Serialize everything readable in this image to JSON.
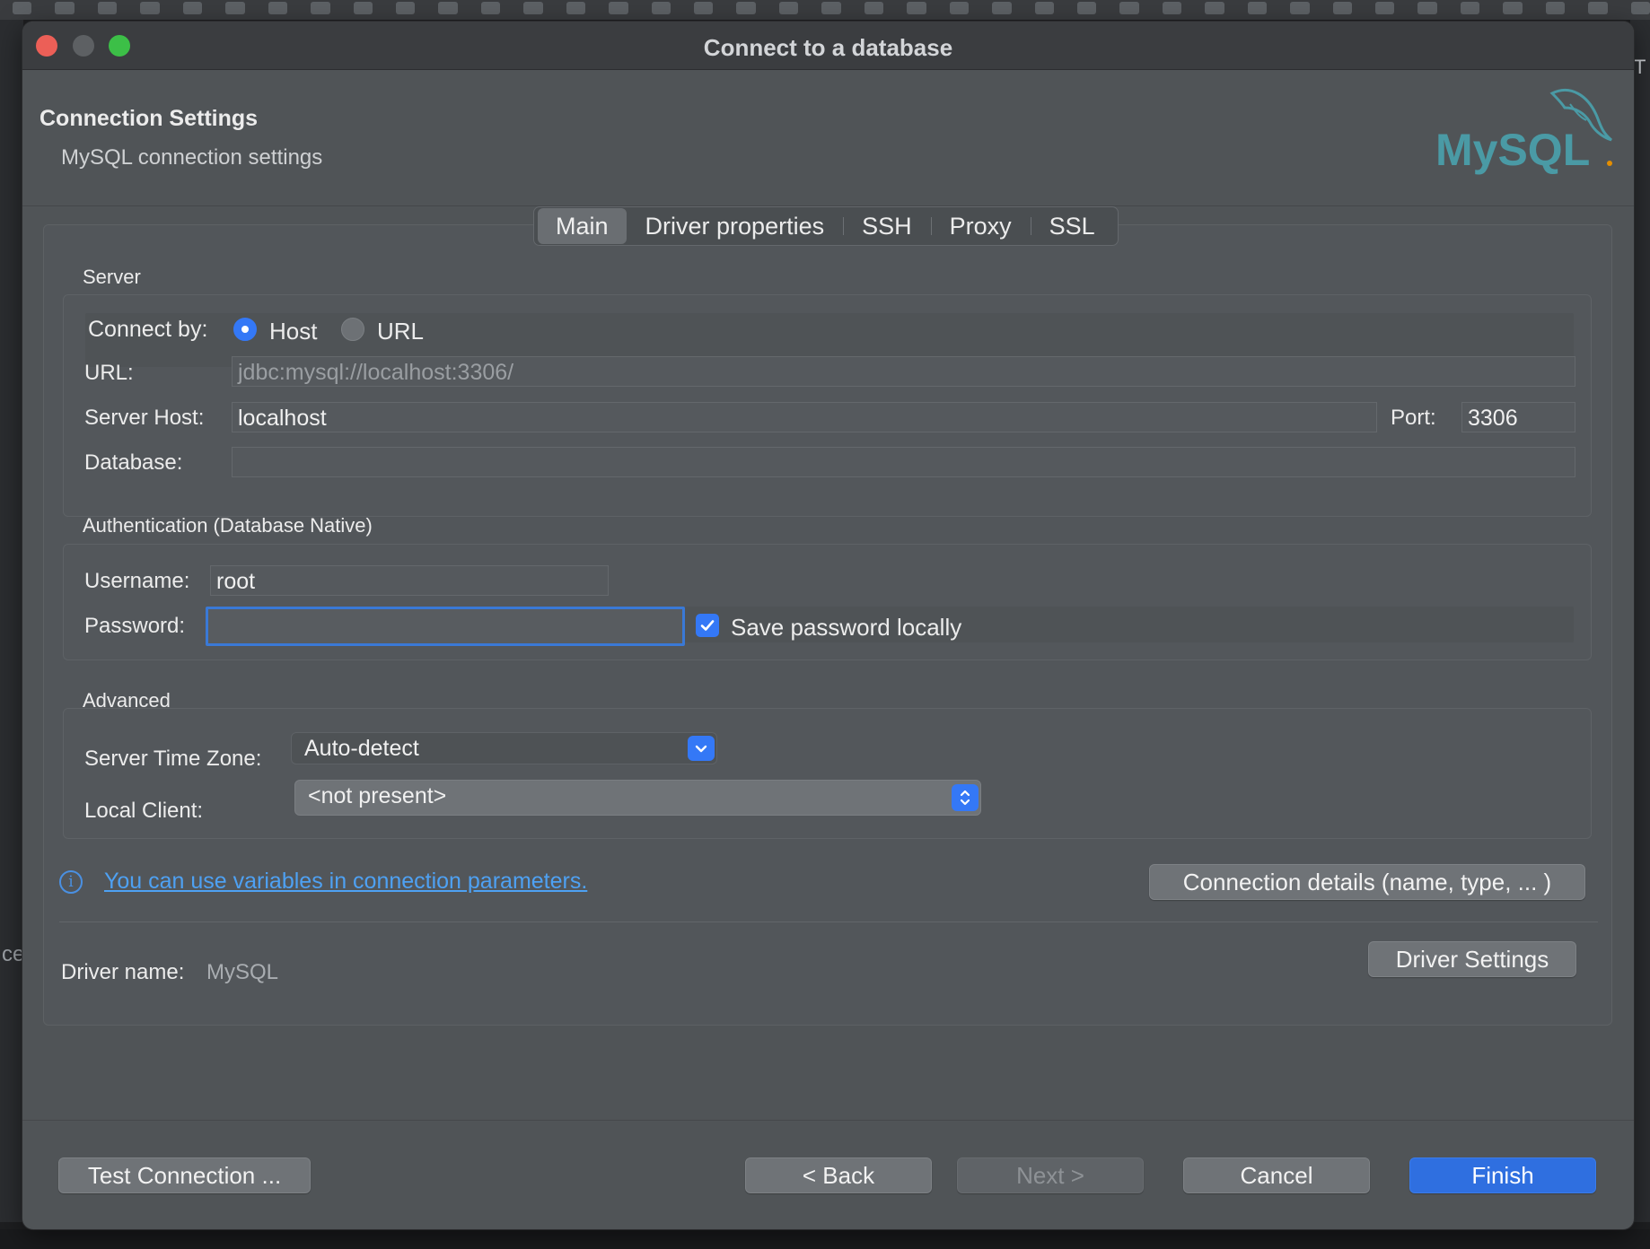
{
  "window": {
    "title": "Connect to a database"
  },
  "header": {
    "title": "Connection Settings",
    "subtitle": "MySQL connection settings",
    "logo_text": "MySQL"
  },
  "tabs": [
    {
      "label": "Main",
      "active": true
    },
    {
      "label": "Driver properties",
      "active": false
    },
    {
      "label": "SSH",
      "active": false
    },
    {
      "label": "Proxy",
      "active": false
    },
    {
      "label": "SSL",
      "active": false
    }
  ],
  "server": {
    "section_label": "Server",
    "connect_by_label": "Connect by:",
    "connect_by_options": [
      "Host",
      "URL"
    ],
    "connect_by_selected": "Host",
    "url_label": "URL:",
    "url_value": "jdbc:mysql://localhost:3306/",
    "host_label": "Server Host:",
    "host_value": "localhost",
    "port_label": "Port:",
    "port_value": "3306",
    "database_label": "Database:",
    "database_value": ""
  },
  "auth": {
    "section_label": "Authentication (Database Native)",
    "username_label": "Username:",
    "username_value": "root",
    "password_label": "Password:",
    "password_value": "",
    "save_password_label": "Save password locally",
    "save_password_checked": true
  },
  "advanced": {
    "section_label": "Advanced",
    "timezone_label": "Server Time Zone:",
    "timezone_value": "Auto-detect",
    "local_client_label": "Local Client:",
    "local_client_value": "<not present>"
  },
  "info": {
    "variables_link": "You can use variables in connection parameters.",
    "connection_details_button": "Connection details (name, type, ... )"
  },
  "driver": {
    "name_label": "Driver name:",
    "name_value": "MySQL",
    "settings_button": "Driver Settings"
  },
  "footer": {
    "test_connection": "Test Connection ...",
    "back": "< Back",
    "next": "Next >",
    "cancel": "Cancel",
    "finish": "Finish"
  },
  "background": {
    "left_fragment": "ce",
    "right_fragment": "T"
  },
  "colors": {
    "accent": "#3478f6",
    "link": "#4ea1f3",
    "dialog_bg": "#505457",
    "mysql_teal": "#4a9aa5",
    "mysql_orange": "#e48e00"
  }
}
